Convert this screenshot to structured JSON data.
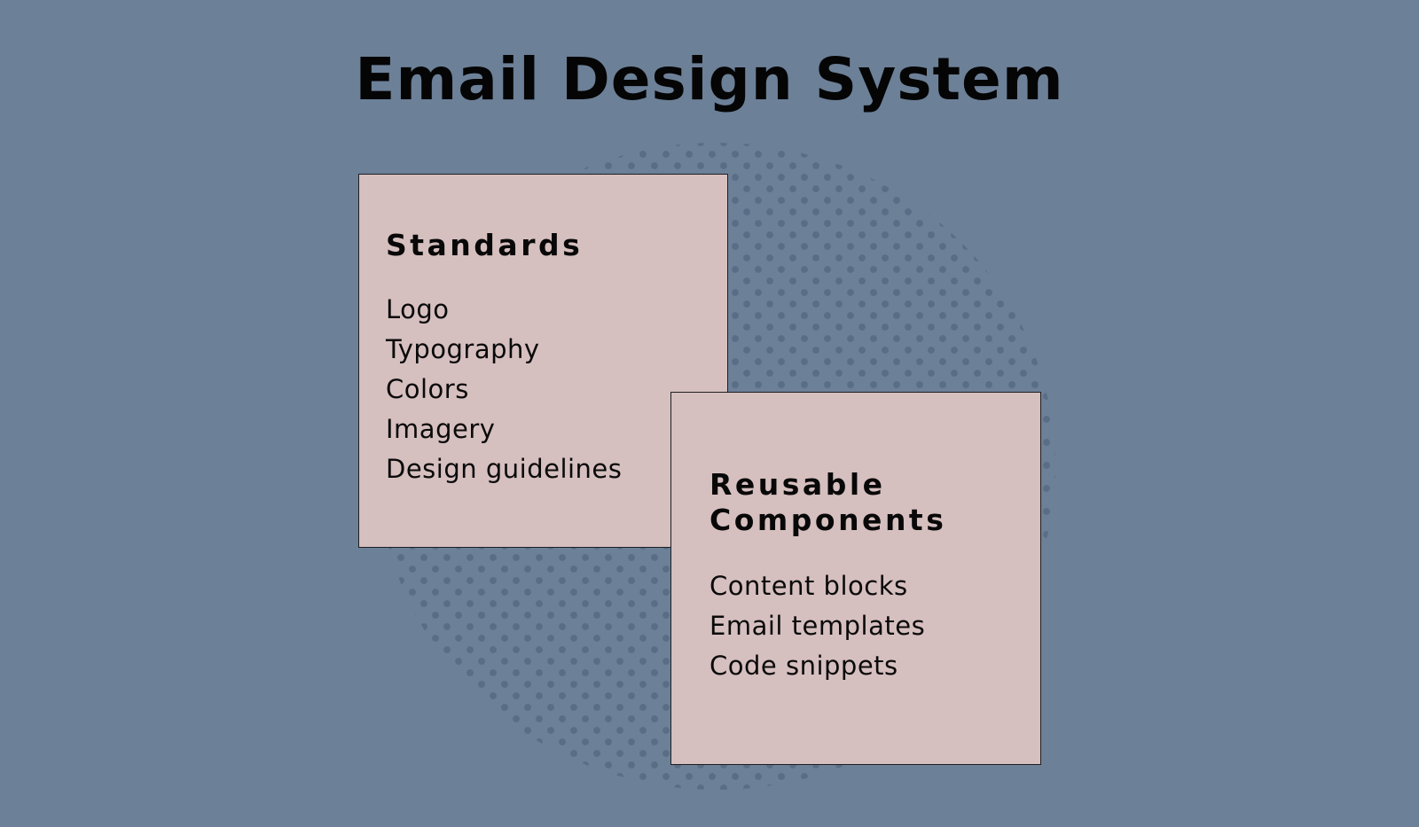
{
  "title": "Email Design System",
  "colors": {
    "background": "#6c8098",
    "card_fill": "#d6bfbf",
    "card_border": "#1e1e22",
    "dot_pattern": "#5a6d86",
    "text": "#0a0a0a"
  },
  "cards": [
    {
      "heading": "Standards",
      "items": [
        "Logo",
        "Typography",
        "Colors",
        "Imagery",
        "Design guidelines"
      ]
    },
    {
      "heading_lines": [
        "Reusable",
        "Components"
      ],
      "items": [
        "Content blocks",
        "Email templates",
        "Code snippets"
      ]
    }
  ]
}
